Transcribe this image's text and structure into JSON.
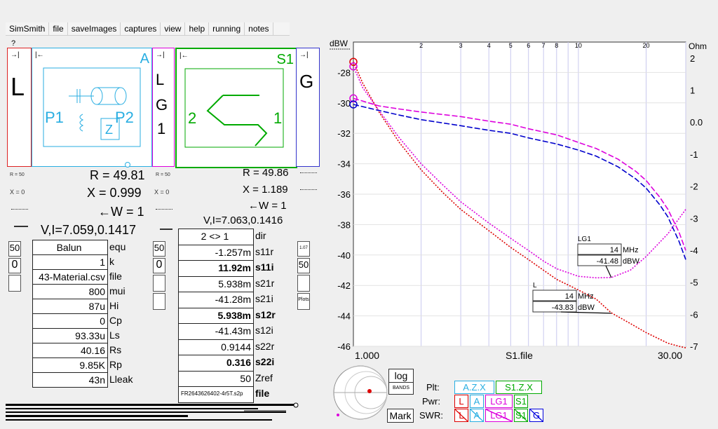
{
  "app": {
    "question_mark": "?"
  },
  "menu": [
    "SimSmith",
    "file",
    "saveImages",
    "captures",
    "view",
    "help",
    "running",
    "notes"
  ],
  "left_panel": {
    "L_letter": "L",
    "A_letter": "A",
    "P1": "P1",
    "P2": "P2",
    "LG1": [
      "L",
      "G",
      "1"
    ],
    "S1_letter": "S1",
    "G_letter": "G",
    "port2": "2",
    "port1": "1",
    "R_left": "R = 49.81",
    "X_left": "X = 0.999",
    "W_left": "←W = 1",
    "VI_left": "V,I=7.059,0.1417",
    "R_right": "R = 49.86",
    "X_right": "X = 1.189",
    "W_right": "←W = 1",
    "VI_right": "V,I=7.063,0.1416",
    "small_r50": "R = 50",
    "small_x0": "X = 0",
    "small_r50b": "R = 50",
    "small_x0b": "X = 0",
    "arrow": "→|",
    "arrow_left": "|←"
  },
  "a_table": [
    {
      "value": "Balun",
      "label": "equ"
    },
    {
      "value": "1",
      "label": "k"
    },
    {
      "value": "43-Material.csv",
      "label": "file"
    },
    {
      "value": "800",
      "label": "mui"
    },
    {
      "value": "87u",
      "label": "Hi"
    },
    {
      "value": "0",
      "label": "Cp"
    },
    {
      "value": "93.33u",
      "label": "Ls"
    },
    {
      "value": "40.16",
      "label": "Rs"
    },
    {
      "value": "9.85K",
      "label": "Rp"
    },
    {
      "value": "43n",
      "label": "Lleak"
    }
  ],
  "s_table": [
    {
      "value": "2 <> 1",
      "label": "dir",
      "bold": false
    },
    {
      "value": "-1.257m",
      "label": "s11r",
      "bold": false
    },
    {
      "value": "11.92m",
      "label": "s11i",
      "bold": true
    },
    {
      "value": "5.938m",
      "label": "s21r",
      "bold": false
    },
    {
      "value": "-41.28m",
      "label": "s21i",
      "bold": false
    },
    {
      "value": "5.938m",
      "label": "s12r",
      "bold": true
    },
    {
      "value": "-41.43m",
      "label": "s12i",
      "bold": false
    },
    {
      "value": "0.9144",
      "label": "s22r",
      "bold": false
    },
    {
      "value": "0.316",
      "label": "s22i",
      "bold": true
    },
    {
      "value": "50",
      "label": "Zref",
      "bold": false
    },
    {
      "value": "FR2643626402-4r5T.s2p",
      "label": "file",
      "bold": false
    }
  ],
  "side_boxes": {
    "a": "50",
    "b": "0",
    "c": "50",
    "d": "0",
    "e": "1.07",
    "f": "50",
    "g": "Plots"
  },
  "chart_data": {
    "type": "line",
    "xlabel": "S1.file",
    "x_start_label": "1.000",
    "x_end_label": "30.00",
    "x_top_ticks": [
      "2",
      "3",
      "4",
      "5",
      "6",
      "7",
      "8",
      "10",
      "20"
    ],
    "x_top_values": [
      2,
      3,
      4,
      5,
      6,
      7,
      8,
      10,
      20
    ],
    "xlim": [
      1,
      30
    ],
    "xscale": "log",
    "left_unit": "dBW",
    "right_unit": "Ohm",
    "ylim_left": [
      -46,
      -26
    ],
    "y_left_ticks": [
      -28,
      -30,
      -32,
      -34,
      -36,
      -38,
      -40,
      -42,
      -44,
      -46
    ],
    "ylim_right": [
      -7,
      2.5
    ],
    "y_right_ticks": [
      2,
      1,
      0.0,
      -1,
      -2,
      -3,
      -4,
      -5,
      -6,
      -7
    ],
    "y_right_labels": [
      "2",
      "1",
      "0.0",
      "-1",
      "-2",
      "-3",
      "-4",
      "-5",
      "-6",
      "-7"
    ],
    "series": [
      {
        "color": "#dd0000",
        "dash": "2,2",
        "x": [
          1.0,
          1.1,
          1.3,
          1.6,
          2,
          2.5,
          3,
          4,
          5,
          6,
          7,
          8,
          10,
          12,
          14,
          17,
          20,
          25,
          28,
          30
        ],
        "y": [
          -27.3,
          -28.7,
          -30.6,
          -32.6,
          -34.4,
          -35.9,
          -37.0,
          -38.4,
          -39.5,
          -40.3,
          -41.0,
          -41.6,
          -42.3,
          -42.9,
          -43.8,
          -44.5,
          -45.1,
          -45.8,
          -46.0,
          -46.1
        ]
      },
      {
        "color": "#dd00dd",
        "dash": "2,2",
        "x": [
          1.0,
          1.1,
          1.3,
          1.6,
          2,
          2.5,
          3,
          4,
          5,
          6,
          7,
          8,
          10,
          12,
          14,
          17,
          20,
          25,
          28,
          30
        ],
        "y": [
          -27.6,
          -29.0,
          -30.5,
          -32.3,
          -34.0,
          -35.4,
          -36.5,
          -37.9,
          -38.9,
          -39.7,
          -40.4,
          -40.9,
          -41.4,
          -41.5,
          -41.48,
          -41.0,
          -40.1,
          -38.6,
          -37.6,
          -37.0
        ]
      },
      {
        "color": "#dd00dd",
        "dash": "8,3",
        "x": [
          1.0,
          1.3,
          1.6,
          2,
          3,
          4,
          5,
          6,
          8,
          10,
          12,
          15,
          18,
          20,
          23,
          25,
          28,
          30
        ],
        "y": [
          -29.7,
          -30.2,
          -30.4,
          -30.6,
          -30.9,
          -31.2,
          -31.4,
          -31.7,
          -32.1,
          -32.6,
          -33.0,
          -33.7,
          -34.5,
          -35.1,
          -36.2,
          -37.0,
          -38.5,
          -39.7
        ]
      },
      {
        "color": "#0000cc",
        "dash": "8,3",
        "x": [
          1.0,
          1.3,
          1.6,
          2,
          3,
          4,
          5,
          6,
          8,
          10,
          12,
          15,
          18,
          20,
          23,
          25,
          28,
          30
        ],
        "y": [
          -30.1,
          -30.5,
          -30.8,
          -31.1,
          -31.5,
          -31.8,
          -32.0,
          -32.3,
          -32.7,
          -33.1,
          -33.5,
          -34.2,
          -35.0,
          -35.6,
          -36.7,
          -37.5,
          -39.1,
          -40.3
        ]
      }
    ],
    "markers": [
      {
        "name": "LG1",
        "freq": "14",
        "freq_unit": "MHz",
        "value": "-41.48",
        "value_unit": "dBW"
      },
      {
        "name": "L",
        "freq": "14",
        "freq_unit": "MHz",
        "value": "-43.83",
        "value_unit": "dBW"
      }
    ]
  },
  "bottom": {
    "log": "log",
    "bands": "BANDS",
    "mark": "Mark",
    "plt": "Plt:",
    "pwr": "Pwr:",
    "swr": "SWR:",
    "plt_items": [
      "A.Z.X",
      "S1.Z.X"
    ],
    "pwr_items": [
      "L",
      "A",
      "LG1",
      "S1"
    ],
    "swr_items": [
      "L",
      "A",
      "LG1",
      "S1",
      "G"
    ],
    "colors": {
      "L": "#dd0000",
      "A": "#29aee2",
      "LG1": "#dd00dd",
      "S1": "#00aa00",
      "G": "#0000dd"
    }
  }
}
